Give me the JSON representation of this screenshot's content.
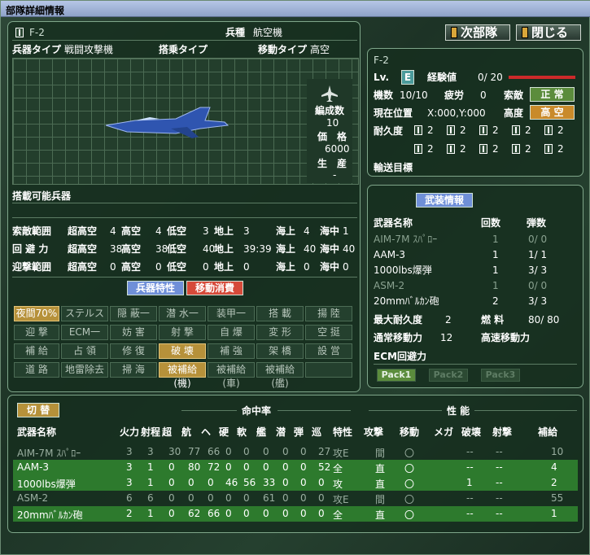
{
  "window": {
    "title": "部隊詳細情報"
  },
  "top_buttons": {
    "next": "次部隊",
    "close": "閉じる"
  },
  "unit": {
    "name": "F-2",
    "type_label": "兵種",
    "type_value": "航空機",
    "weapon_type_label": "兵器タイプ",
    "weapon_type_value": "戦闘攻撃機",
    "board_type_label": "搭乗タイプ",
    "move_type_label": "移動タイプ",
    "move_type_value": "高空",
    "formation_label": "編成数",
    "formation_value": "10",
    "price_label": "価　格",
    "price_value": "6000",
    "produce_label": "生　産",
    "produce_value": "-"
  },
  "loadable": {
    "label": "搭載可能兵器"
  },
  "ranges": [
    {
      "label": "索敵範囲",
      "vals": [
        "超高空",
        "4",
        "高空",
        "4",
        "低空",
        "3",
        "地上",
        "3",
        "海上",
        "4",
        "海中",
        "1"
      ]
    },
    {
      "label": "回 避 力",
      "vals": [
        "超高空",
        "38",
        "高空",
        "38",
        "低空",
        "40",
        "地上",
        "39:39",
        "海上",
        "40",
        "海中",
        "40"
      ]
    },
    {
      "label": "迎撃範囲",
      "vals": [
        "超高空",
        "0",
        "高空",
        "0",
        "低空",
        "0",
        "地上",
        "0",
        "海上",
        "0",
        "海中",
        "0"
      ]
    }
  ],
  "tabs": {
    "traits": "兵器特性",
    "move_cost": "移動消費"
  },
  "traits_grid": [
    [
      "夜間70%",
      "ステルス一",
      "隠 蔽一",
      "潜 水一",
      "装甲一",
      "搭 載",
      "揚 陸"
    ],
    [
      "迎 撃",
      "ECM一",
      "妨 害",
      "射 撃",
      "自 爆",
      "変 形",
      "空 挺"
    ],
    [
      "補 給",
      "占 領",
      "修 復",
      "破 壊",
      "補 強",
      "架 橋",
      "設 営"
    ],
    [
      "道 路",
      "地雷除去",
      "掃 海",
      "被補給(機)",
      "被補給(車)",
      "被補給(艦)",
      ""
    ]
  ],
  "status": {
    "name": "F-2",
    "lv_label": "Lv.",
    "lv_value": "E",
    "exp_label": "経験値",
    "exp_value": "0/ 20",
    "units_label": "機数",
    "units_value": "10/10",
    "fatigue_label": "疲労",
    "fatigue_value": "0",
    "search_label": "索敵",
    "search_value": "正 常",
    "pos_label": "現在位置",
    "pos_value": "X:000,Y:000",
    "alt_label": "高度",
    "alt_value": "高 空",
    "dur_label": "耐久度",
    "dur_vals": [
      "2",
      "2",
      "2",
      "2",
      "2",
      "2",
      "2",
      "2",
      "2",
      "2"
    ],
    "transport_label": "輸送目標"
  },
  "armament": {
    "title": "武装情報",
    "headers": [
      "武器名称",
      "回数",
      "弾数"
    ],
    "rows": [
      [
        "AIM-7M ｽﾊﾟﾛｰ",
        "1",
        "0/ 0"
      ],
      [
        "AAM-3",
        "1",
        "1/ 1"
      ],
      [
        "1000lbs爆弾",
        "1",
        "3/ 3"
      ],
      [
        "ASM-2",
        "1",
        "0/ 0"
      ],
      [
        "20mmﾊﾞﾙｶﾝ砲",
        "2",
        "3/ 3"
      ]
    ],
    "max_dur_label": "最大耐久度",
    "max_dur_value": "2",
    "fuel_label": "燃 料",
    "fuel_value": "80/ 80",
    "normal_move_label": "通常移動力",
    "normal_move_value": "12",
    "fast_move_label": "高速移動力",
    "ecm_label": "ECM回避力",
    "packs": [
      "Pack1",
      "Pack2",
      "Pack3"
    ]
  },
  "weapons": {
    "switch_label": "切 替",
    "hit_label": "命中率",
    "perf_label": "性 能",
    "headers": [
      "武器名称",
      "火力",
      "射程",
      "超",
      "航",
      "ヘ",
      "硬",
      "軟",
      "艦",
      "潜",
      "弾",
      "巡",
      "特性",
      "攻撃",
      "移動",
      "メガ",
      "破壊",
      "射撃",
      "補給"
    ],
    "rows": [
      [
        "AIM-7M ｽﾊﾟﾛｰ",
        "3",
        "3",
        "30",
        "77",
        "66",
        "0",
        "0",
        "0",
        "0",
        "0",
        "27",
        "攻E",
        "間",
        "〇",
        "",
        "--",
        "--",
        "10"
      ],
      [
        "AAM-3",
        "3",
        "1",
        "0",
        "80",
        "72",
        "0",
        "0",
        "0",
        "0",
        "0",
        "52",
        "全",
        "直",
        "〇",
        "",
        "--",
        "--",
        "4"
      ],
      [
        "1000lbs爆弾",
        "3",
        "1",
        "0",
        "0",
        "0",
        "46",
        "56",
        "33",
        "0",
        "0",
        "0",
        "攻",
        "直",
        "〇",
        "",
        "1",
        "--",
        "2"
      ],
      [
        "ASM-2",
        "6",
        "6",
        "0",
        "0",
        "0",
        "0",
        "0",
        "61",
        "0",
        "0",
        "0",
        "攻E",
        "間",
        "〇",
        "",
        "--",
        "--",
        "55"
      ],
      [
        "20mmﾊﾞﾙｶﾝ砲",
        "2",
        "1",
        "0",
        "62",
        "66",
        "0",
        "0",
        "0",
        "0",
        "0",
        "0",
        "全",
        "直",
        "〇",
        "",
        "--",
        "--",
        "1"
      ]
    ]
  },
  "colors": {
    "highlight_row": "#2d7a2d",
    "tag_green": "#5b8c3c",
    "tag_orange": "#c98a2a",
    "gauge_red": "#cc2a2a",
    "tab_blue": "#6f8fd8",
    "tab_red": "#d64a3a"
  }
}
